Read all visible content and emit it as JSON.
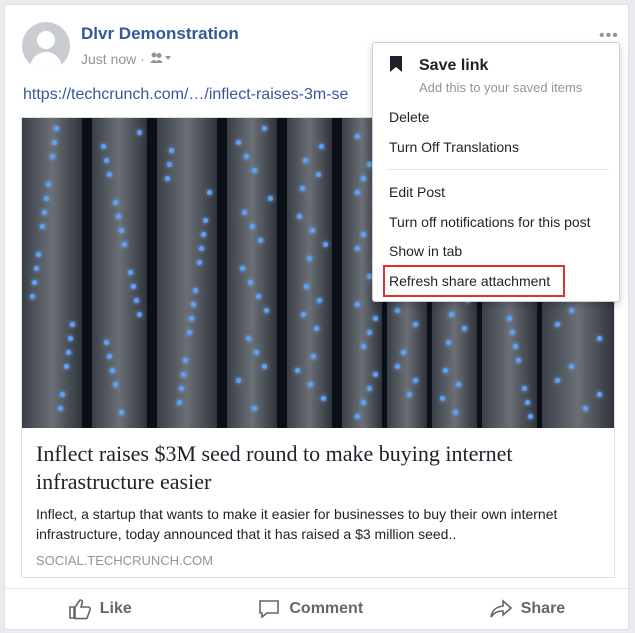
{
  "post": {
    "author": "Dlvr Demonstration",
    "time": "Just now",
    "dot": "·",
    "link": "https://techcrunch.com/…/inflect-raises-3m-se"
  },
  "attachment": {
    "headline": "Inflect raises $3M seed round to make buying internet infrastructure easier",
    "description": "Inflect, a startup that wants to make it easier for businesses to buy their own internet infrastructure, today announced that it has raised a $3 million seed..",
    "domain": "SOCIAL.TECHCRUNCH.COM"
  },
  "actions": {
    "like": "Like",
    "comment": "Comment",
    "share": "Share"
  },
  "menu": {
    "save_title": "Save link",
    "save_subtitle": "Add this to your saved items",
    "delete": "Delete",
    "turn_off_translations": "Turn Off Translations",
    "edit_post": "Edit Post",
    "turn_off_notifications": "Turn off notifications for this post",
    "show_in_tab": "Show in tab",
    "refresh_share": "Refresh share attachment"
  },
  "more_glyph": "•••",
  "colors": {
    "link": "#365899",
    "highlight": "#e0312f"
  }
}
